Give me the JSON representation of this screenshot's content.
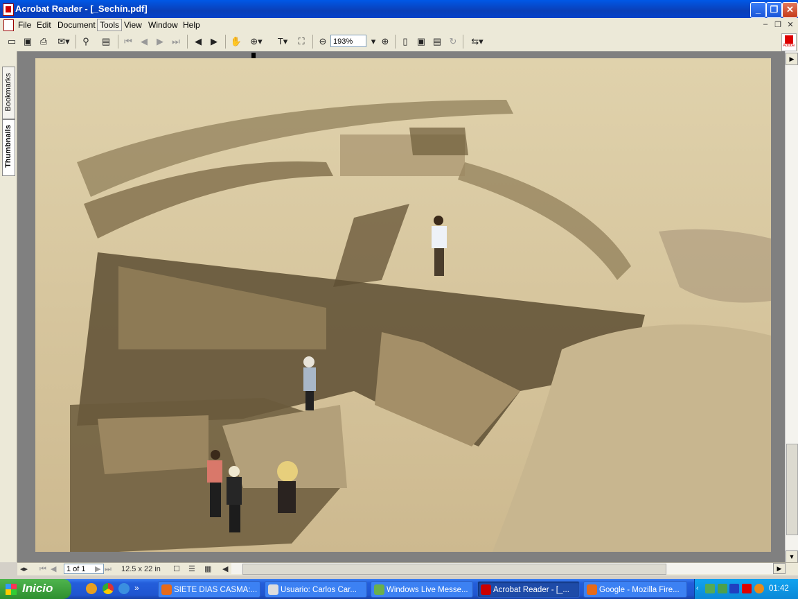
{
  "window": {
    "title": "Acrobat Reader - [_Sechín.pdf]"
  },
  "menu": [
    "File",
    "Edit",
    "Document",
    "Tools",
    "View",
    "Window",
    "Help"
  ],
  "toolbar": {
    "zoom_value": "193%",
    "icons": [
      "open-icon",
      "save-icon",
      "print-icon",
      "email-icon",
      "search-icon",
      "bookmark-panel-icon",
      "first-page-icon",
      "previous-page-icon",
      "next-page-icon",
      "last-page-icon",
      "back-icon",
      "forward-icon",
      "hand-tool-icon",
      "zoom-tool-icon",
      "text-select-icon",
      "snapshot-icon",
      "zoom-out-icon",
      "zoom-in-icon",
      "single-page-icon",
      "fit-page-icon",
      "fit-width-icon",
      "rotate-icon",
      "tasks-icon"
    ],
    "adobe_label": "Adobe"
  },
  "side_tabs": {
    "bookmarks": "Bookmarks",
    "thumbnails": "Thumbnails"
  },
  "document": {
    "image_subject": "archaeological excavation photograph"
  },
  "status": {
    "page_field": "1 of 1",
    "page_size": "12.5 x 22 in"
  },
  "taskbar": {
    "start_label": "Inicio",
    "tasks": [
      {
        "label": "SIETE DIAS CASMA:...",
        "icon": "firefox-icon"
      },
      {
        "label": "Usuario:  Carlos Car...",
        "icon": "wiki-icon"
      },
      {
        "label": "Windows Live Messe...",
        "icon": "messenger-icon"
      },
      {
        "label": "Acrobat Reader - [_...",
        "icon": "acrobat-icon",
        "active": true
      },
      {
        "label": "Google - Mozilla Fire...",
        "icon": "firefox-icon"
      }
    ],
    "clock": "01:42"
  }
}
